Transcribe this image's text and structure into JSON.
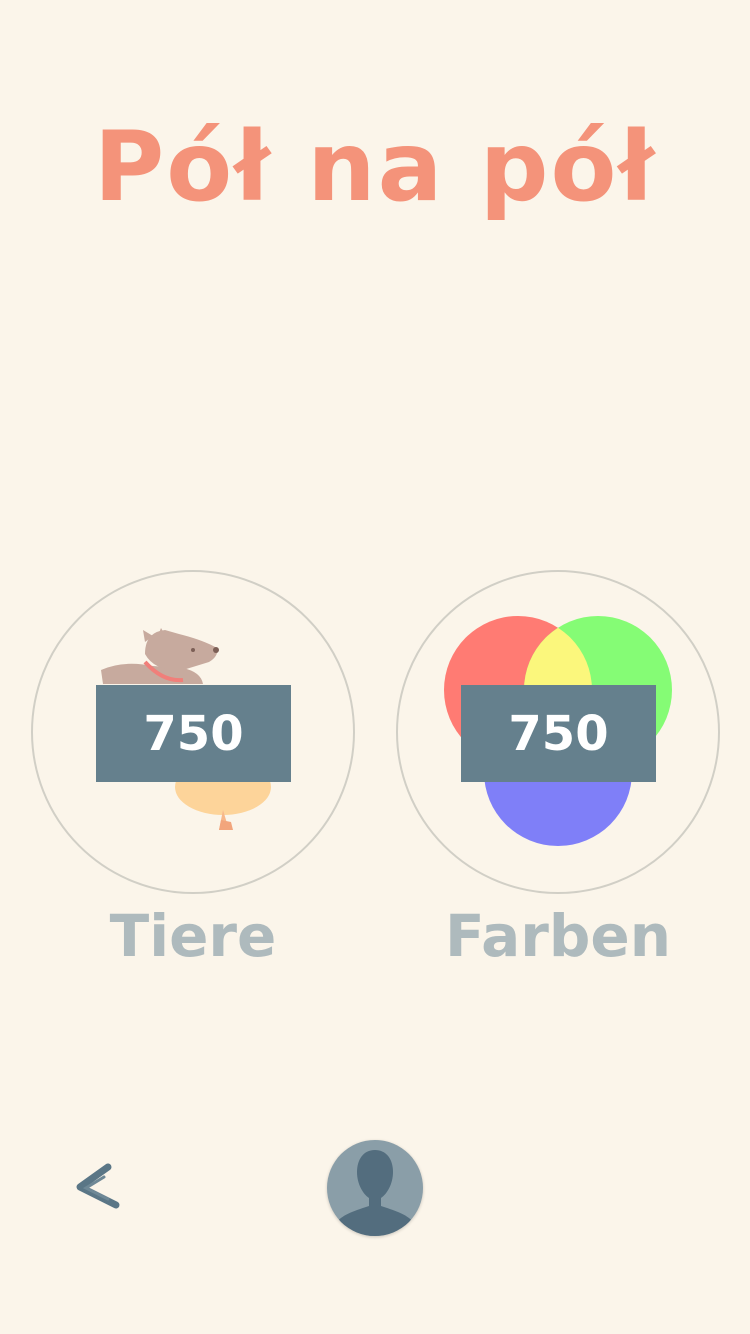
{
  "app": {
    "title": "Pół na pół"
  },
  "categories": [
    {
      "label": "Tiere",
      "score": "750",
      "icon": "dog-balloon-icon"
    },
    {
      "label": "Farben",
      "score": "750",
      "icon": "color-venn-icon"
    }
  ],
  "footer": {
    "back_icon": "chevron-left-icon",
    "profile_icon": "user-silhouette-icon"
  },
  "colors": {
    "background": "#fbf5ea",
    "title": "#f4937a",
    "score_box": "#65808d",
    "label": "#aebabd",
    "avatar_bg": "#8a9ea8",
    "avatar_fg": "#536d7e",
    "venn_red": "#ff7b73",
    "venn_green": "#85fc75",
    "venn_yellow": "#fbf77c",
    "venn_blue": "#7f7ff8"
  }
}
